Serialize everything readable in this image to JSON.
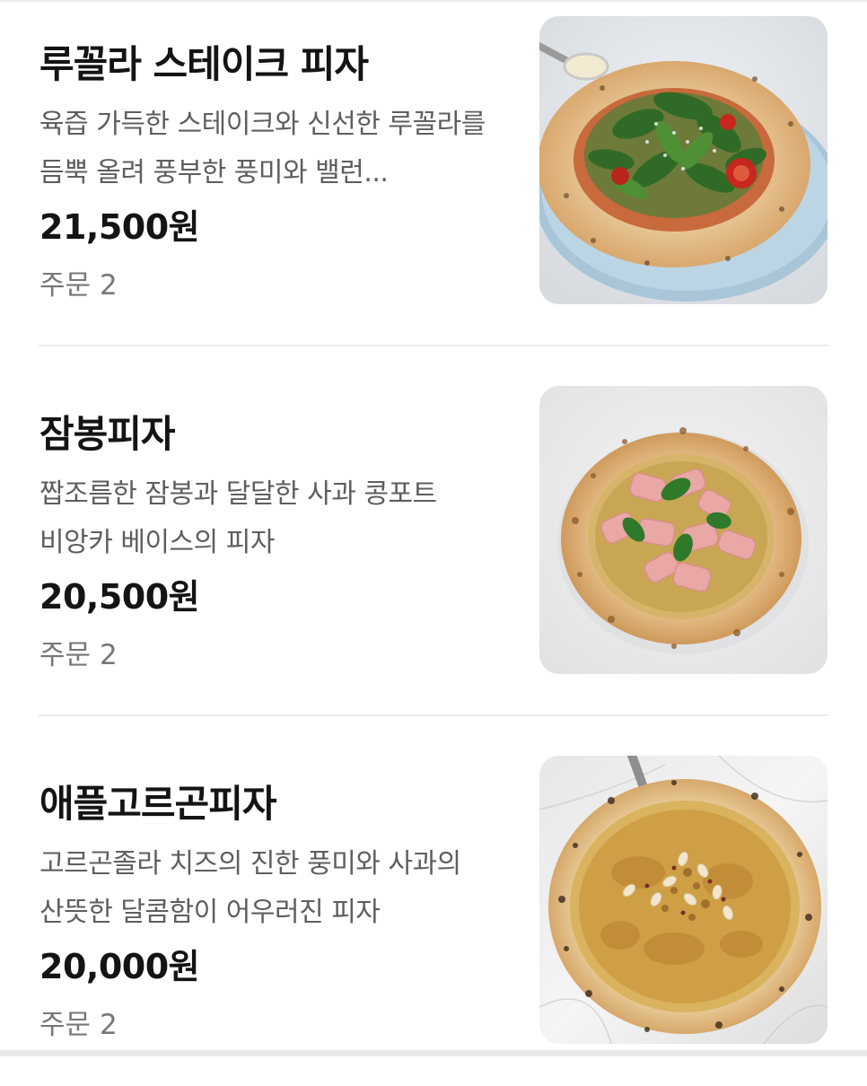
{
  "menu": {
    "order_label": "주문",
    "items": [
      {
        "name": "루꼴라 스테이크 피자",
        "description": "육즙 가득한 스테이크와 신선한 루꼴라를 듬뿍 올려 풍부한 풍미와 밸런...",
        "price": "21,500원",
        "order_count": "2",
        "photo": "rucola-steak-pizza-photo"
      },
      {
        "name": "잠봉피자",
        "description": "짭조름한 잠봉과 달달한 사과 콩포트 비앙카 베이스의 피자",
        "price": "20,500원",
        "order_count": "2",
        "photo": "jambon-pizza-photo"
      },
      {
        "name": "애플고르곤피자",
        "description": "고르곤졸라 치즈의 진한 풍미와 사과의 산뜻한 달콤함이 어우러진 피자",
        "price": "20,000원",
        "order_count": "2",
        "photo": "apple-gorgonzola-pizza-photo"
      }
    ]
  },
  "colors": {
    "title": "#141414",
    "description": "#5e5e5e",
    "order_text": "#777777",
    "divider": "#ececec"
  }
}
